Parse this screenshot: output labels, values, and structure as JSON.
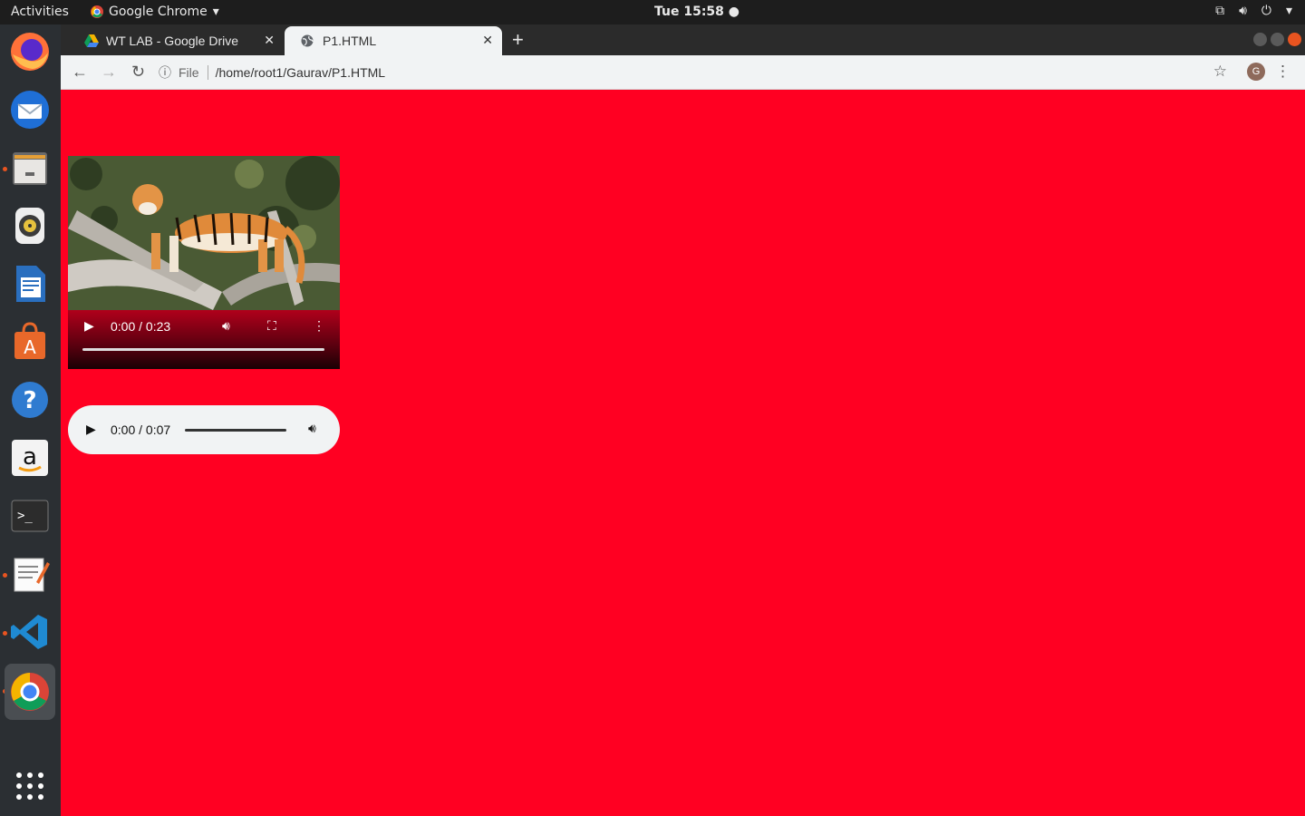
{
  "topbar": {
    "activities": "Activities",
    "app_name": "Google Chrome",
    "clock": "Tue 15:58"
  },
  "dock": {
    "items": [
      "firefox-icon",
      "thunderbird-icon",
      "files-icon",
      "rhythmbox-icon",
      "writer-icon",
      "software-icon",
      "help-icon",
      "amazon-icon",
      "terminal-icon",
      "text-editor-icon",
      "vscode-icon",
      "chrome-icon",
      "apps-grid-icon"
    ]
  },
  "browser": {
    "tabs": [
      {
        "label": "WT LAB - Google Drive",
        "active": false
      },
      {
        "label": "P1.HTML",
        "active": true
      }
    ],
    "omnibox": {
      "scheme_label": "File",
      "url": "/home/root1/Gaurav/P1.HTML"
    },
    "avatar_letter": "G"
  },
  "page": {
    "background": "#ff0022",
    "video": {
      "time": "0:00 / 0:23",
      "progress": 0
    },
    "audio": {
      "time": "0:00 / 0:07",
      "progress": 0
    }
  }
}
